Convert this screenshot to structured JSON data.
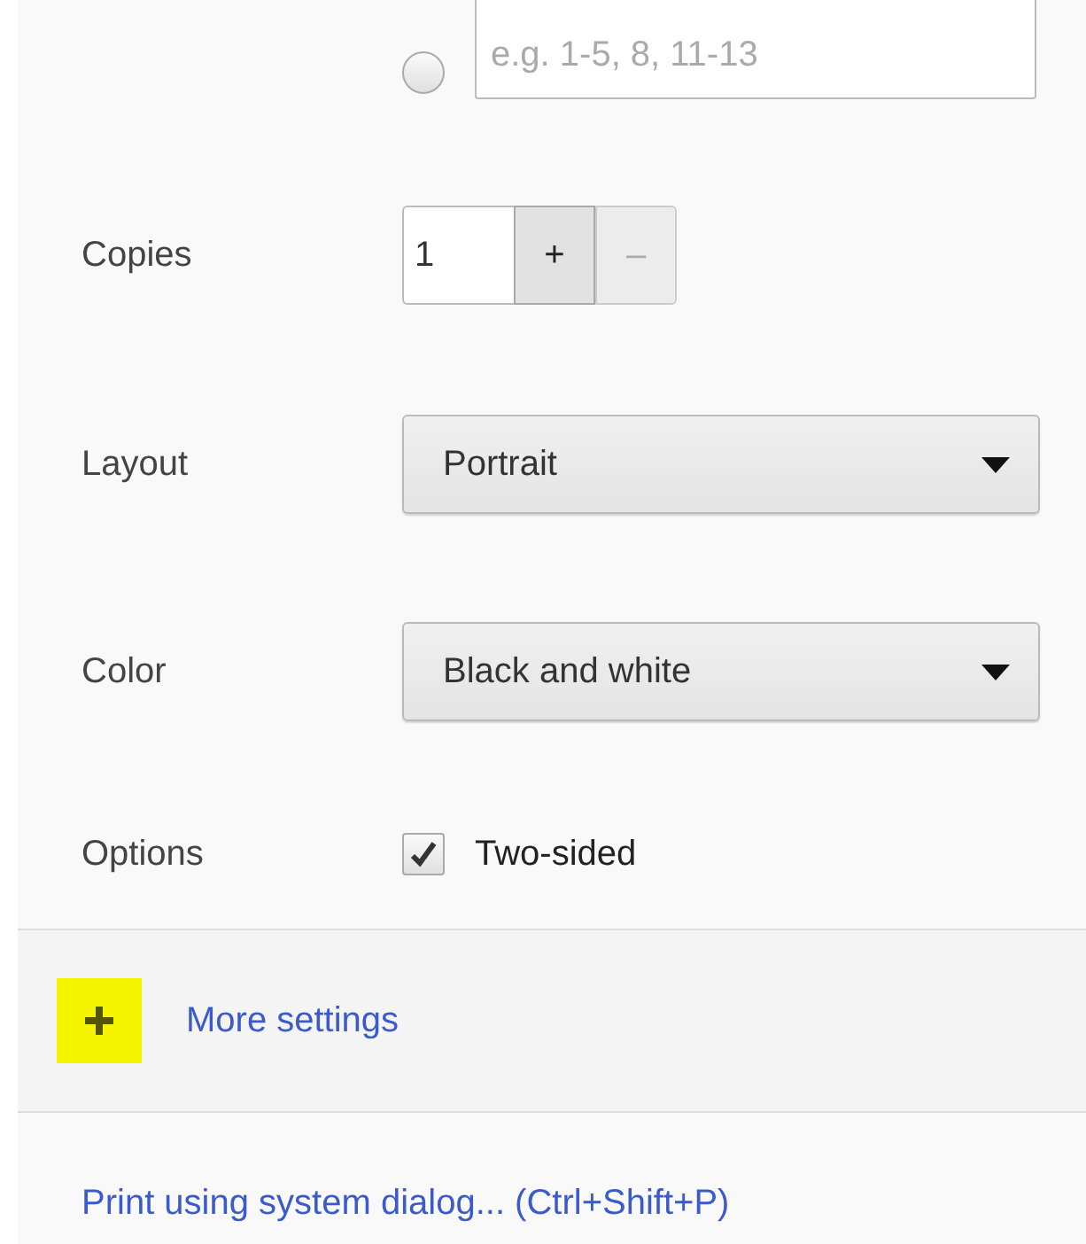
{
  "pages": {
    "radio_selected": false,
    "placeholder": "e.g. 1-5, 8, 11-13"
  },
  "copies": {
    "label": "Copies",
    "value": "1",
    "increment": {
      "label": "+",
      "disabled": false
    },
    "decrement": {
      "label": "–",
      "disabled": true
    }
  },
  "selects": [
    {
      "label": "Layout",
      "value": "Portrait"
    },
    {
      "label": "Color",
      "value": "Black and white"
    }
  ],
  "options": {
    "label": "Options",
    "checkbox": {
      "label": "Two-sided",
      "checked": true
    }
  },
  "more_settings": {
    "label": "More settings",
    "expanded": false
  },
  "system_dialog_link": "Print using system dialog... (Ctrl+Shift+P)"
}
